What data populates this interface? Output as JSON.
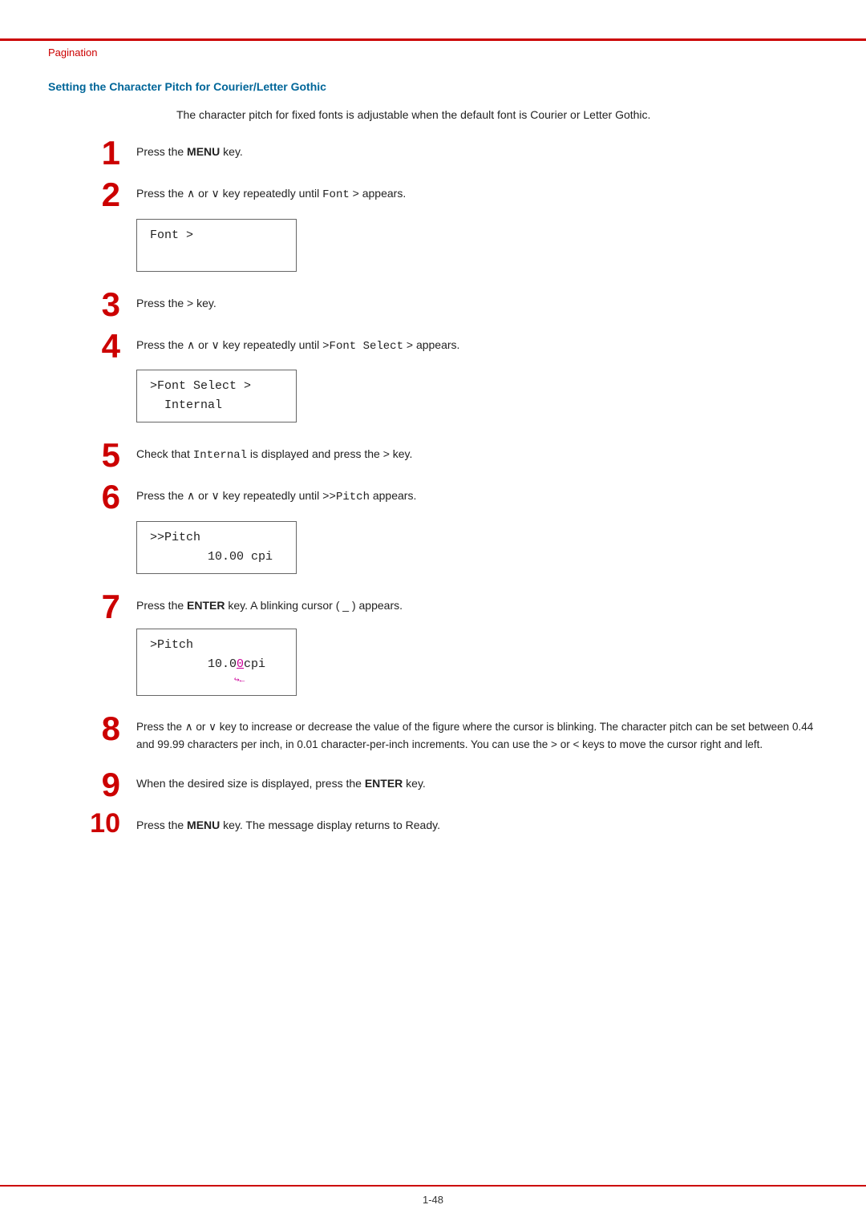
{
  "page": {
    "top_line_color": "#cc0000",
    "pagination_label": "Pagination",
    "page_number": "1-48",
    "section_heading": "Setting the Character Pitch for Courier/Letter Gothic",
    "intro_text": "The character pitch for fixed fonts is adjustable when the default font is Courier or Letter Gothic.",
    "steps": [
      {
        "num": "1",
        "text": "Press the ",
        "key": "MENU",
        "text2": " key.",
        "has_display": false
      },
      {
        "num": "2",
        "text_before": "Press the ∧ or ∨ key repeatedly until ",
        "mono1": "Font",
        "text_after": " > appears.",
        "has_display": true,
        "display_lines": [
          "Font                >",
          ""
        ]
      },
      {
        "num": "3",
        "text": "Press the > key.",
        "has_display": false
      },
      {
        "num": "4",
        "text_before": "Press the ∧ or ∨ key repeatedly until ",
        "mono1": ">Font Select",
        "text_after": " > appears.",
        "has_display": true,
        "display_lines": [
          ">Font Select  >",
          "  Internal"
        ]
      },
      {
        "num": "5",
        "text_before": "Check that ",
        "mono1": "Internal",
        "text_after": " is displayed and press the > key.",
        "has_display": false
      },
      {
        "num": "6",
        "text_before": "Press the ∧ or ∨ key repeatedly until ",
        "mono1": ">>Pitch",
        "text_after": " appears.",
        "has_display": true,
        "display_lines": [
          ">>Pitch",
          "        10.00 cpi"
        ]
      },
      {
        "num": "7",
        "text_before": "Press the ",
        "key": "ENTER",
        "text_after": " key. A blinking cursor ( _ ) appears.",
        "has_display": true,
        "display_type": "cursor",
        "display_lines": [
          ">Pitch",
          "        10.0"
        ]
      },
      {
        "num": "8",
        "text": "Press the ∧ or ∨ key to increase or decrease the value of the figure where the cursor is blinking. The character pitch can be set between 0.44 and 99.99 characters per inch, in 0.01 character-per-inch increments. You can use the > or < keys to move the cursor right and left.",
        "has_display": false,
        "is_paragraph": true
      },
      {
        "num": "9",
        "text_before": "When the desired size is displayed, press the ",
        "key": "ENTER",
        "text_after": " key.",
        "has_display": false
      },
      {
        "num": "10",
        "text_before": "Press the ",
        "key": "MENU",
        "text_after": " key. The message display returns to Ready.",
        "has_display": false,
        "num_small": true
      }
    ]
  }
}
